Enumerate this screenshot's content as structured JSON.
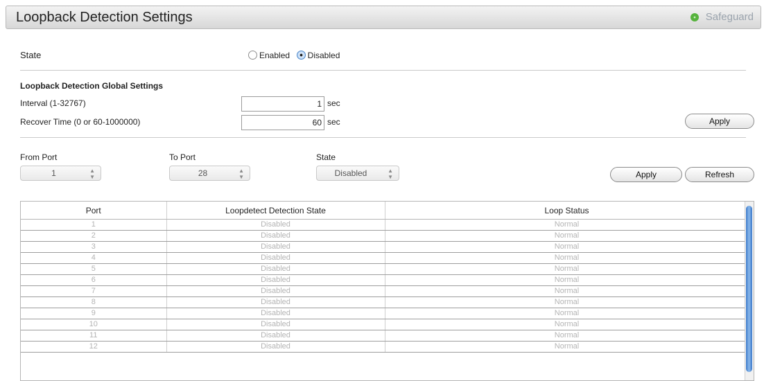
{
  "header": {
    "title": "Loopback Detection Settings",
    "safeguard_label": "Safeguard"
  },
  "state_section": {
    "label": "State",
    "options": [
      {
        "label": "Enabled",
        "checked": false
      },
      {
        "label": "Disabled",
        "checked": true
      }
    ]
  },
  "global_settings": {
    "heading": "Loopback Detection Global Settings",
    "interval_label": "Interval (1-32767)",
    "interval_value": "1",
    "interval_unit": "sec",
    "recover_label": "Recover Time (0 or 60-1000000)",
    "recover_value": "60",
    "recover_unit": "sec",
    "apply_label": "Apply"
  },
  "port_settings": {
    "from_port_label": "From Port",
    "from_port_value": "1",
    "to_port_label": "To Port",
    "to_port_value": "28",
    "state_label": "State",
    "state_value": "Disabled",
    "apply_label": "Apply",
    "refresh_label": "Refresh"
  },
  "table": {
    "columns": [
      "Port",
      "Loopdetect Detection State",
      "Loop Status"
    ],
    "rows": [
      [
        "1",
        "Disabled",
        "Normal"
      ],
      [
        "2",
        "Disabled",
        "Normal"
      ],
      [
        "3",
        "Disabled",
        "Normal"
      ],
      [
        "4",
        "Disabled",
        "Normal"
      ],
      [
        "5",
        "Disabled",
        "Normal"
      ],
      [
        "6",
        "Disabled",
        "Normal"
      ],
      [
        "7",
        "Disabled",
        "Normal"
      ],
      [
        "8",
        "Disabled",
        "Normal"
      ],
      [
        "9",
        "Disabled",
        "Normal"
      ],
      [
        "10",
        "Disabled",
        "Normal"
      ],
      [
        "11",
        "Disabled",
        "Normal"
      ],
      [
        "12",
        "Disabled",
        "Normal"
      ]
    ]
  },
  "icons": {
    "safeguard": "status-dot-icon",
    "select_arrows": "up-down-arrows-icon"
  },
  "colors": {
    "safeguard_green": "#57b33e",
    "scroll_blue": "#3b78c9"
  }
}
